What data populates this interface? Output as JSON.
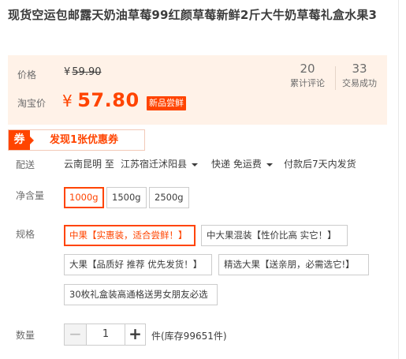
{
  "title": "现货空运包邮露天奶油草莓99红颜草莓新鲜2斤大牛奶草莓礼盒水果3",
  "price": {
    "orig_label": "价格",
    "orig_currency": "¥",
    "orig_value": "59.90",
    "tb_label": "淘宝价",
    "tb_currency": "¥",
    "tb_value": "57.80",
    "badge": "新品尝鲜",
    "accent_color": "#ff4400"
  },
  "stats": [
    {
      "count": "20",
      "label": "累计评论"
    },
    {
      "count": "33",
      "label": "交易成功"
    }
  ],
  "coupon": {
    "tag": "券",
    "text": "发现1张优惠券"
  },
  "shipping": {
    "label": "配送",
    "from": "云南昆明 至",
    "to": "江苏宿迁沭阳县",
    "method": "快递 免运费",
    "note": "付款后7天内发货"
  },
  "net_weight": {
    "label": "净含量",
    "options": [
      "1000g",
      "1500g",
      "2500g"
    ],
    "selected": "1000g"
  },
  "spec": {
    "label": "规格",
    "options": [
      "中果【实惠装，适合尝鲜！】",
      "中大果混装【性价比高 实它！】",
      "大果【品质好 推荐 优先发货！】",
      "精选大果【送亲朋，必需选它!】",
      "30枚礼盒装高通格送男女朋友必选"
    ],
    "selected": "中果【实惠装，适合尝鲜！】"
  },
  "quantity": {
    "label": "数量",
    "minus": "−",
    "value": "1",
    "plus": "+",
    "stock_text": "件(库存99651件)"
  }
}
